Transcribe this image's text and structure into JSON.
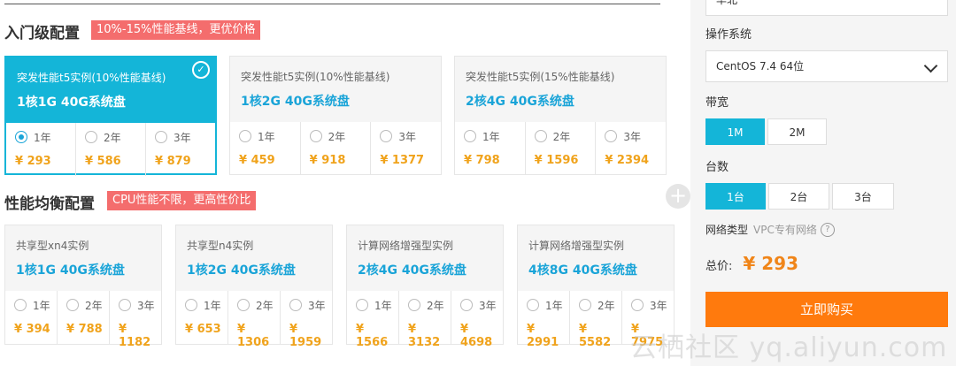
{
  "sections": [
    {
      "title": "入门级配置",
      "badge": "10%-15%性能基线，更优价格",
      "cards": [
        {
          "type": "突发性能t5实例(10%性能基线)",
          "spec": "1核1G 40G系统盘",
          "selected": true,
          "options": [
            {
              "label": "1年",
              "price": "¥ 293",
              "checked": true
            },
            {
              "label": "2年",
              "price": "¥ 586"
            },
            {
              "label": "3年",
              "price": "¥ 879"
            }
          ]
        },
        {
          "type": "突发性能t5实例(10%性能基线)",
          "spec": "1核2G 40G系统盘",
          "options": [
            {
              "label": "1年",
              "price": "¥ 459"
            },
            {
              "label": "2年",
              "price": "¥ 918"
            },
            {
              "label": "3年",
              "price": "¥ 1377"
            }
          ]
        },
        {
          "type": "突发性能t5实例(15%性能基线)",
          "spec": "2核4G 40G系统盘",
          "options": [
            {
              "label": "1年",
              "price": "¥ 798"
            },
            {
              "label": "2年",
              "price": "¥ 1596"
            },
            {
              "label": "3年",
              "price": "¥ 2394"
            }
          ]
        }
      ]
    },
    {
      "title": "性能均衡配置",
      "badge": "CPU性能不限，更高性价比",
      "cards": [
        {
          "type": "共享型xn4实例",
          "spec": "1核1G 40G系统盘",
          "options": [
            {
              "label": "1年",
              "price": "¥ 394"
            },
            {
              "label": "2年",
              "price": "¥ 788"
            },
            {
              "label": "3年",
              "price": "¥ 1182"
            }
          ]
        },
        {
          "type": "共享型n4实例",
          "spec": "1核2G 40G系统盘",
          "options": [
            {
              "label": "1年",
              "price": "¥ 653"
            },
            {
              "label": "2年",
              "price": "¥ 1306"
            },
            {
              "label": "3年",
              "price": "¥ 1959"
            }
          ]
        },
        {
          "type": "计算网络增强型实例",
          "spec": "2核4G 40G系统盘",
          "options": [
            {
              "label": "1年",
              "price": "¥ 1566"
            },
            {
              "label": "2年",
              "price": "¥ 3132"
            },
            {
              "label": "3年",
              "price": "¥ 4698"
            }
          ]
        },
        {
          "type": "计算网络增强型实例",
          "spec": "4核8G 40G系统盘",
          "options": [
            {
              "label": "1年",
              "price": "¥ 2991"
            },
            {
              "label": "2年",
              "price": "¥ 5582"
            },
            {
              "label": "3年",
              "price": "¥ 7975"
            }
          ]
        }
      ]
    }
  ],
  "panel": {
    "region_value": "华北",
    "os_label": "操作系统",
    "os_value": "CentOS 7.4 64位",
    "bandwidth_label": "带宽",
    "bandwidth_options": [
      "1M",
      "2M"
    ],
    "bandwidth_selected": "1M",
    "count_label": "台数",
    "count_options": [
      "1台",
      "2台",
      "3台"
    ],
    "count_selected": "1台",
    "network_label": "网络类型",
    "network_value": "VPC专有网络",
    "help_icon": "question-icon",
    "total_label": "总价:",
    "total_value": "¥ 293",
    "buy_label": "立即购买"
  },
  "colors": {
    "accent": "#14b5d8",
    "price": "#f0a31c",
    "buy": "#ff7a0d",
    "badge": "#f46d6d"
  },
  "watermark": "云栖社区 yq.aliyun.com"
}
